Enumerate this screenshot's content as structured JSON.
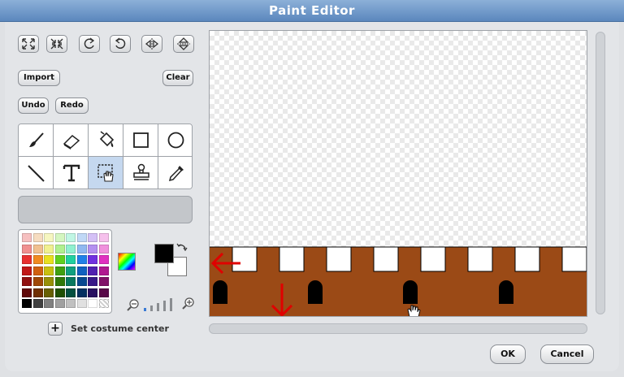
{
  "window": {
    "title": "Paint Editor"
  },
  "toolbar": {
    "icons": [
      "grow-icon",
      "shrink-icon",
      "rotate-left-icon",
      "rotate-right-icon",
      "flip-horizontal-icon",
      "flip-vertical-icon"
    ],
    "import_label": "Import",
    "clear_label": "Clear",
    "undo_label": "Undo",
    "redo_label": "Redo"
  },
  "tools": [
    "paintbrush",
    "eraser",
    "fill",
    "rectangle",
    "ellipse",
    "line",
    "text",
    "select",
    "stamp",
    "eyedropper"
  ],
  "active_tool": "select",
  "colors": {
    "foreground": "#000000",
    "background": "#ffffff",
    "castle_brown": "#9b4a16",
    "arrow_red": "#e00000"
  },
  "costume_center": {
    "label": "Set costume center"
  },
  "footer": {
    "ok_label": "OK",
    "cancel_label": "Cancel"
  }
}
